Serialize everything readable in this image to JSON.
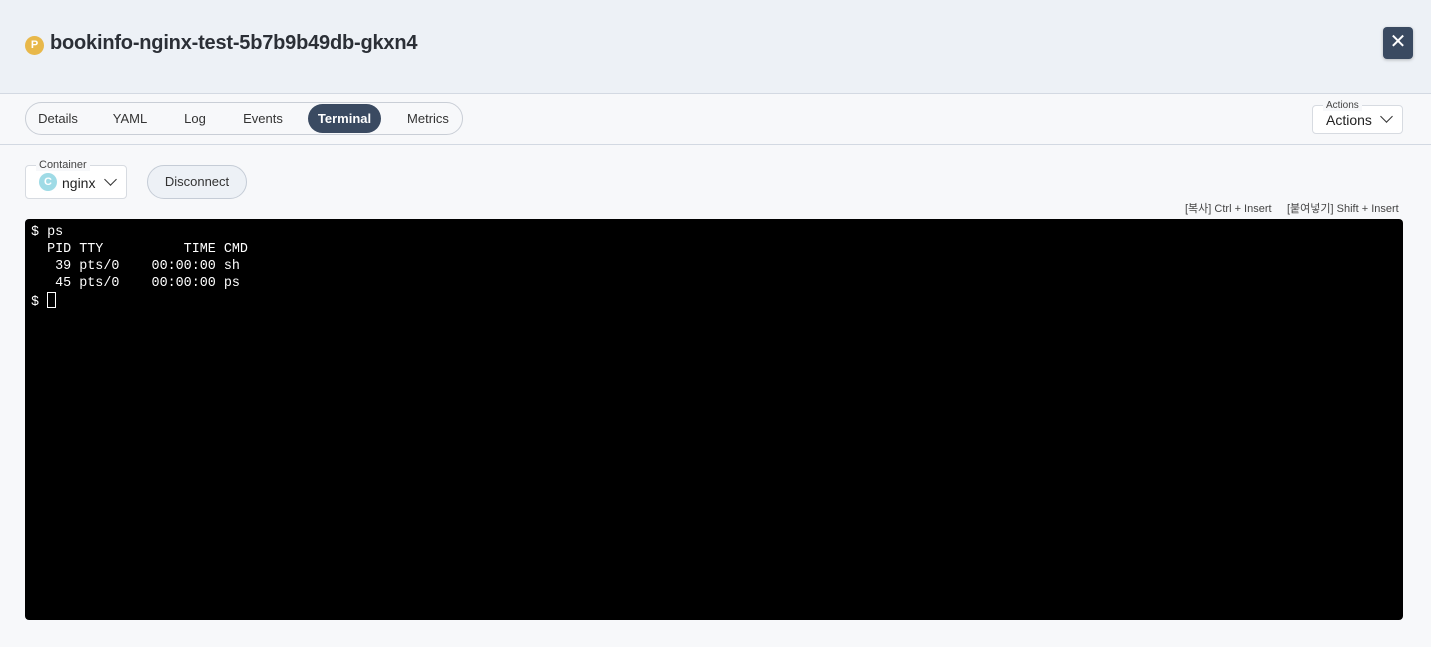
{
  "header": {
    "pod_badge": "P",
    "title": "bookinfo-nginx-test-5b7b9b49db-gkxn4",
    "close_icon": "close-icon"
  },
  "tabs": [
    {
      "label": "Details",
      "active": false
    },
    {
      "label": "YAML",
      "active": false
    },
    {
      "label": "Log",
      "active": false
    },
    {
      "label": "Events",
      "active": false
    },
    {
      "label": "Terminal",
      "active": true
    },
    {
      "label": "Metrics",
      "active": false
    }
  ],
  "actions": {
    "legend": "Actions",
    "value": "Actions"
  },
  "container": {
    "legend": "Container",
    "badge": "C",
    "value": "nginx"
  },
  "disconnect_label": "Disconnect",
  "hints": {
    "copy": "[복사] Ctrl + Insert",
    "paste": "[붙여넣기] Shift + Insert"
  },
  "terminal": {
    "lines": [
      "$ ps",
      "  PID TTY          TIME CMD",
      "   39 pts/0    00:00:00 sh",
      "   45 pts/0    00:00:00 ps"
    ],
    "prompt": "$ "
  },
  "colors": {
    "accent": "#3a4a61",
    "header_bg": "#edf1f6",
    "pod_badge": "#e8b84a",
    "container_badge": "#9fdbe6",
    "terminal_bg": "#000000"
  }
}
